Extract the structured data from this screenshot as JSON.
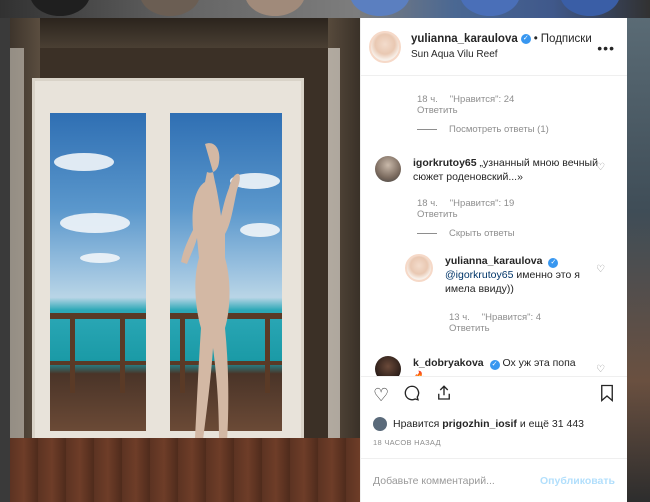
{
  "post": {
    "author": "yulianna_karaulova",
    "follow_separator": "•",
    "follow_label": "Подписки",
    "location": "Sun Aqua Vilu Reef",
    "more_label": "•••"
  },
  "comments": {
    "c1": {
      "time": "18 ч.",
      "likes": "\"Нравится\": 24",
      "reply": "Ответить",
      "view_replies": "Посмотреть ответы (1)"
    },
    "c2": {
      "user": "igorkrutoy65",
      "text": "„узнанный мною вечный сюжет роденовский...»",
      "time": "18 ч.",
      "likes": "\"Нравится\": 19",
      "reply": "Ответить",
      "hide_replies": "Скрыть ответы"
    },
    "c3": {
      "user": "yulianna_karaulova",
      "mention": "@igorkrutoy65",
      "text": "именно это я имела ввиду))",
      "time": "13 ч.",
      "likes": "\"Нравится\": 4",
      "reply": "Ответить"
    },
    "c4": {
      "user": "k_dobryakova",
      "text": "Ох уж эта попа",
      "emoji": "🔥"
    }
  },
  "actions": {
    "like_icon": "heart-icon",
    "comment_icon": "comment-icon",
    "share_icon": "share-icon",
    "bookmark_icon": "bookmark-icon"
  },
  "likes": {
    "prefix": "Нравится",
    "user": "prigozhin_iosif",
    "suffix": "и ещё 31 443"
  },
  "timestamp": "18 ЧАСОВ НАЗАД",
  "add_comment": {
    "placeholder": "Добавьте комментарий...",
    "publish_label": "Опубликовать"
  },
  "colors": {
    "accent": "#3897f0",
    "mention": "#003569",
    "muted": "#8e8e8e",
    "publish_disabled": "#b2dffc"
  }
}
